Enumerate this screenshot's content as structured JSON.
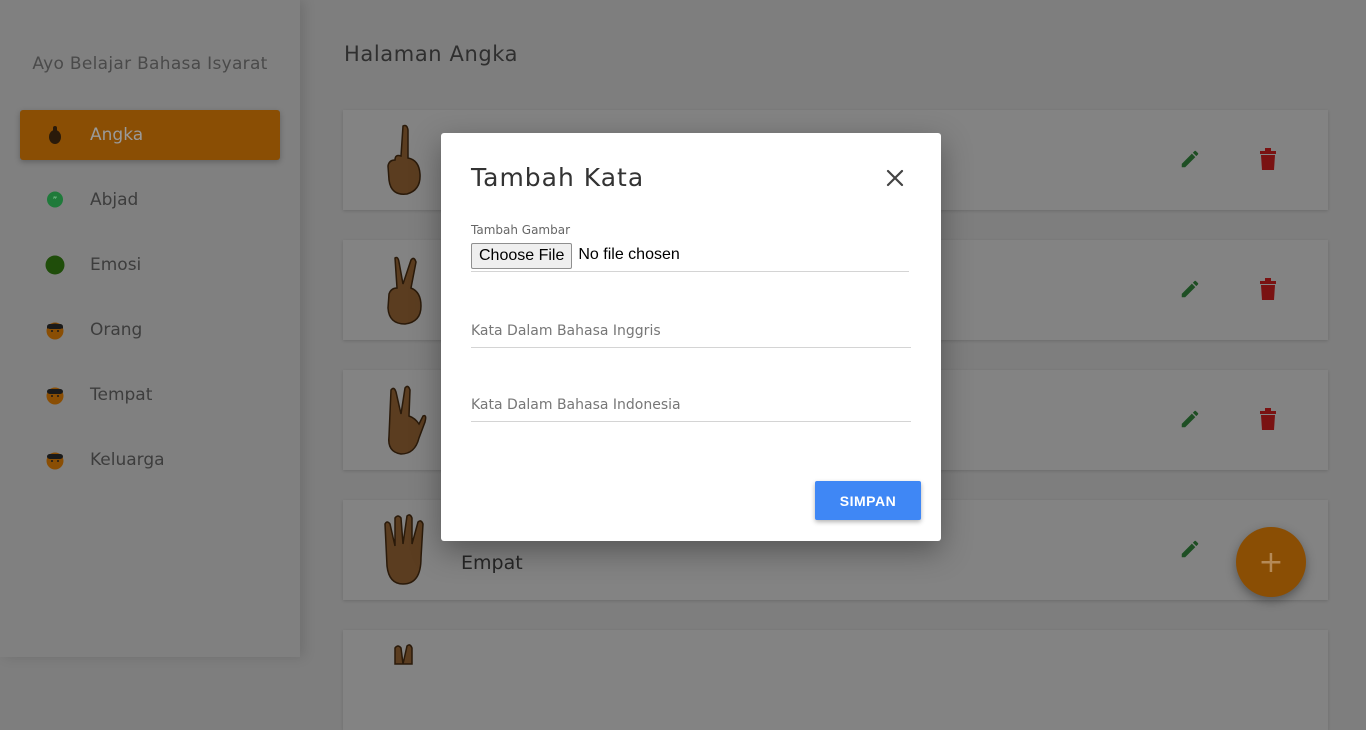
{
  "sidebar": {
    "brand": "Ayo Belajar Bahasa Isyarat",
    "items": [
      {
        "label": "Angka",
        "active": true,
        "icon": "hand-emoji-icon"
      },
      {
        "label": "Abjad",
        "active": false,
        "icon": "speech-bubble-icon"
      },
      {
        "label": "Emosi",
        "active": false,
        "icon": "green-circle-icon"
      },
      {
        "label": "Orang",
        "active": false,
        "icon": "person-emoji-icon"
      },
      {
        "label": "Tempat",
        "active": false,
        "icon": "person-emoji-icon"
      },
      {
        "label": "Keluarga",
        "active": false,
        "icon": "person-emoji-icon"
      }
    ]
  },
  "main": {
    "title": "Halaman Angka",
    "cards": [
      {
        "word": "",
        "icon": "one-finger-hand-icon"
      },
      {
        "word": "",
        "icon": "two-finger-hand-icon"
      },
      {
        "word": "",
        "icon": "three-finger-hand-icon"
      },
      {
        "word": "Empat",
        "icon": "four-finger-hand-icon"
      },
      {
        "word": "",
        "icon": "hand-icon"
      }
    ],
    "fab_label": "+"
  },
  "modal": {
    "title": "Tambah Kata",
    "image_label": "Tambah Gambar",
    "file_button": "Choose File",
    "file_status": "No file chosen",
    "english_placeholder": "Kata Dalam Bahasa Inggris",
    "indonesian_placeholder": "Kata Dalam Bahasa Indonesia",
    "save_label": "SIMPAN"
  },
  "colors": {
    "accent": "#FF8C00",
    "edit": "#2E7D32",
    "delete": "#D32F2F",
    "primary_button": "#4285F4"
  }
}
